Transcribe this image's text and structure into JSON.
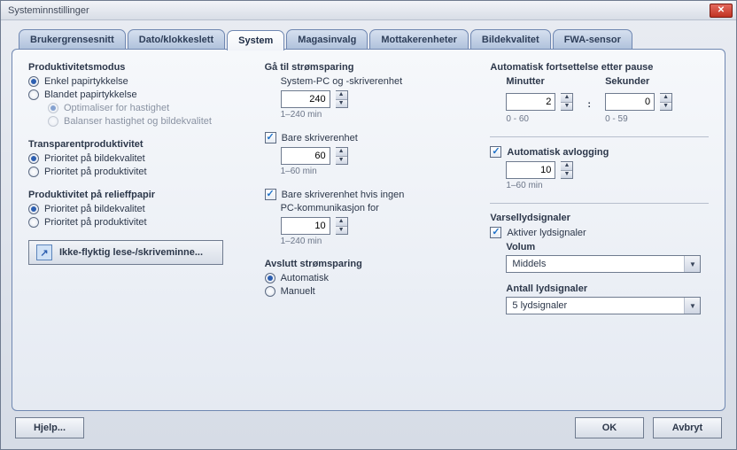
{
  "window": {
    "title": "Systeminnstillinger"
  },
  "tabs": [
    {
      "label": "Brukergrensesnitt"
    },
    {
      "label": "Dato/klokkeslett"
    },
    {
      "label": "System"
    },
    {
      "label": "Magasinvalg"
    },
    {
      "label": "Mottakerenheter"
    },
    {
      "label": "Bildekvalitet"
    },
    {
      "label": "FWA-sensor"
    }
  ],
  "col1": {
    "productivityMode": {
      "title": "Produktivitetsmodus",
      "simple": "Enkel papirtykkelse",
      "mixed": "Blandet papirtykkelse",
      "optSpeed": "Optimaliser for hastighet",
      "balance": "Balanser hastighet og bildekvalitet"
    },
    "transparency": {
      "title": "Transparentproduktivitet",
      "quality": "Prioritet på bildekvalitet",
      "prod": "Prioritet på produktivitet"
    },
    "relief": {
      "title": "Produktivitet på relieffpapir",
      "quality": "Prioritet på bildekvalitet",
      "prod": "Prioritet på produktivitet"
    },
    "nvm": "Ikke-flyktig lese-/skriveminne..."
  },
  "col2": {
    "powerTitle": "Gå til strømsparing",
    "systemPc": "System-PC og -skriverenhet",
    "systemPcVal": "240",
    "range240": "1–240 min",
    "printerOnly": "Bare skriverenhet",
    "printerOnlyVal": "60",
    "range60": "1–60 min",
    "noComm": "Bare skriverenhet hvis ingen",
    "noComm2": "PC-kommunikasjon for",
    "noCommVal": "10",
    "exitTitle": "Avslutt strømsparing",
    "auto": "Automatisk",
    "manual": "Manuelt"
  },
  "col3": {
    "pauseTitle": "Automatisk fortsettelse etter pause",
    "minutes": "Minutter",
    "seconds": "Sekunder",
    "minVal": "2",
    "secVal": "0",
    "minRange": "0 - 60",
    "secRange": "0 - 59",
    "autoLogoff": "Automatisk avlogging",
    "autoLogoffVal": "10",
    "logoffRange": "1–60 min",
    "alertTitle": "Varsellydsignaler",
    "enableAlert": "Aktiver lydsignaler",
    "volumeLabel": "Volum",
    "volumeValue": "Middels",
    "countLabel": "Antall lydsignaler",
    "countValue": "5 lydsignaler"
  },
  "footer": {
    "help": "Hjelp...",
    "ok": "OK",
    "cancel": "Avbryt"
  }
}
